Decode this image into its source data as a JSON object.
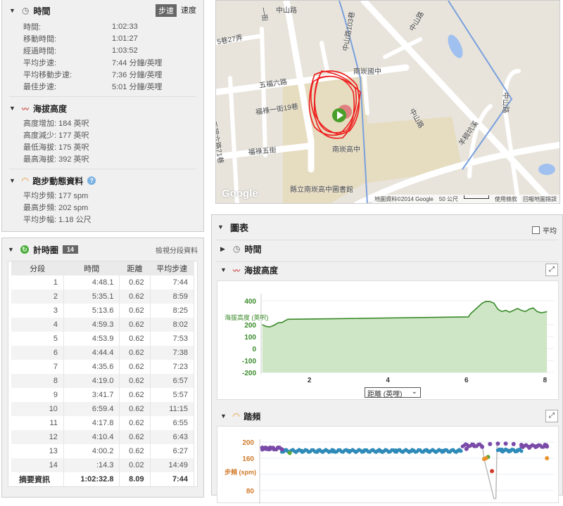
{
  "summary": {
    "time": {
      "title": "時間",
      "toggle": [
        "步速",
        "速度"
      ],
      "rows": [
        [
          "時間:",
          "1:02:33"
        ],
        [
          "移動時間:",
          "1:01:27"
        ],
        [
          "經過時間:",
          "1:03:52"
        ],
        [
          "平均步速:",
          "7:44 分鐘/英哩"
        ],
        [
          "平均移動步速:",
          "7:36 分鐘/英哩"
        ],
        [
          "最佳步速:",
          "5:01 分鐘/英哩"
        ]
      ]
    },
    "elevation": {
      "title": "海拔高度",
      "rows": [
        "高度增加: 184 英呎",
        "高度減少: 177 英呎",
        "最低海拔: 175 英呎",
        "最高海拔: 392 英呎"
      ]
    },
    "dynamics": {
      "title": "跑步動態資料",
      "rows": [
        "平均步頻: 177 spm",
        "最高步頻: 202 spm",
        "平均步幅: 1.18 公尺"
      ]
    }
  },
  "laps": {
    "title": "計時圈",
    "count": "14",
    "view_link": "檢視分段資料",
    "headers": [
      "分段",
      "時間",
      "距離",
      "平均步速"
    ],
    "rows": [
      [
        "1",
        "4:48.1",
        "0.62",
        "7:44"
      ],
      [
        "2",
        "5:35.1",
        "0.62",
        "8:59"
      ],
      [
        "3",
        "5:13.6",
        "0.62",
        "8:25"
      ],
      [
        "4",
        "4:59.3",
        "0.62",
        "8:02"
      ],
      [
        "5",
        "4:53.9",
        "0.62",
        "7:53"
      ],
      [
        "6",
        "4:44.4",
        "0.62",
        "7:38"
      ],
      [
        "7",
        "4:35.6",
        "0.62",
        "7:23"
      ],
      [
        "8",
        "4:19.0",
        "0.62",
        "6:57"
      ],
      [
        "9",
        "3:41.7",
        "0.62",
        "5:57"
      ],
      [
        "10",
        "6:59.4",
        "0.62",
        "11:15"
      ],
      [
        "11",
        "4:17.8",
        "0.62",
        "6:55"
      ],
      [
        "12",
        "4:10.4",
        "0.62",
        "6:43"
      ],
      [
        "13",
        "4:00.2",
        "0.62",
        "6:27"
      ],
      [
        "14",
        ":14.3",
        "0.02",
        "14:49"
      ]
    ],
    "summary": [
      "摘要資訊",
      "1:02:32.8",
      "8.09",
      "7:44"
    ]
  },
  "map": {
    "labels": [
      "中山路",
      "中山路103巷",
      "中山路",
      "中山路",
      "五福六路",
      "福祿一街19巷",
      "五福六路71巷",
      "福祿五街",
      "5巷27弄",
      "南崁國中",
      "南崁高中",
      "縣立南崁高中圖書館",
      "羊稠坑溪",
      "一街",
      "中山路"
    ],
    "logo": "Google",
    "attribution": "地圖資料©2014 Google",
    "scale": "50 公尺",
    "terms": "使用條款",
    "report": "回報地圖錯誤"
  },
  "charts": {
    "title": "圖表",
    "avg_label": "平均",
    "time_title": "時間",
    "elev_title": "海拔高度",
    "cad_title": "踏頻",
    "xaxis_select": "距離 (英哩)"
  },
  "chart_data": [
    {
      "type": "area",
      "title": "海拔高度",
      "ylabel": "海拔高度 (英呎)",
      "xlabel": "距離 (英哩)",
      "ylim": [
        -200,
        400
      ],
      "yticks": [
        400,
        200,
        100,
        0,
        -100,
        -200
      ],
      "xticks": [
        2,
        4,
        6,
        8
      ],
      "color": "#3a8a2a",
      "x": [
        0.8,
        0.9,
        1.0,
        1.1,
        1.2,
        1.3,
        1.45,
        6.05,
        6.1,
        6.2,
        6.3,
        6.4,
        6.5,
        6.6,
        6.7,
        6.8,
        6.9,
        7.0,
        7.1,
        7.2,
        7.3,
        7.4,
        7.5,
        7.6,
        7.7,
        7.8,
        7.9,
        8.0,
        8.05
      ],
      "y": [
        200,
        185,
        182,
        195,
        215,
        218,
        245,
        265,
        290,
        320,
        350,
        380,
        395,
        393,
        380,
        330,
        310,
        320,
        305,
        320,
        335,
        320,
        310,
        330,
        340,
        310,
        300,
        305,
        310
      ]
    },
    {
      "type": "scatter",
      "title": "踏頻",
      "ylabel": "步頻 (spm)",
      "yticks": [
        200,
        160,
        120,
        80
      ],
      "ylim": [
        60,
        210
      ],
      "series": [
        {
          "name": "purple",
          "color": "#7a4aa8",
          "x": [
            0.8,
            0.9,
            1.0,
            1.1,
            1.2,
            1.3,
            6.0,
            6.2,
            6.4,
            6.6,
            6.8,
            7.0,
            7.2,
            7.4,
            7.6,
            7.8,
            8.0,
            8.05
          ],
          "y": [
            186,
            183,
            186,
            182,
            186,
            182,
            183,
            190,
            188,
            195,
            196,
            196,
            195,
            193,
            186,
            190,
            193,
            189
          ]
        },
        {
          "name": "blue",
          "color": "#2e8ab8",
          "x": [
            1.4,
            1.8,
            2.2,
            2.6,
            3.0,
            3.4,
            3.8,
            4.2,
            4.6,
            5.0,
            5.4,
            5.8,
            6.9,
            7.1,
            7.3
          ],
          "y": [
            180,
            178,
            176,
            177,
            178,
            179,
            178,
            179,
            178,
            179,
            178,
            179,
            181,
            178,
            179
          ]
        },
        {
          "name": "green",
          "color": "#5aa83a",
          "x": [
            1.5,
            6.55
          ],
          "y": [
            173,
            163
          ]
        },
        {
          "name": "orange",
          "color": "#e8922a",
          "x": [
            6.45,
            6.5,
            8.05
          ],
          "y": [
            158,
            160,
            160
          ]
        },
        {
          "name": "red",
          "color": "#d03a2a",
          "x": [
            6.65
          ],
          "y": [
            128
          ]
        }
      ]
    }
  ]
}
